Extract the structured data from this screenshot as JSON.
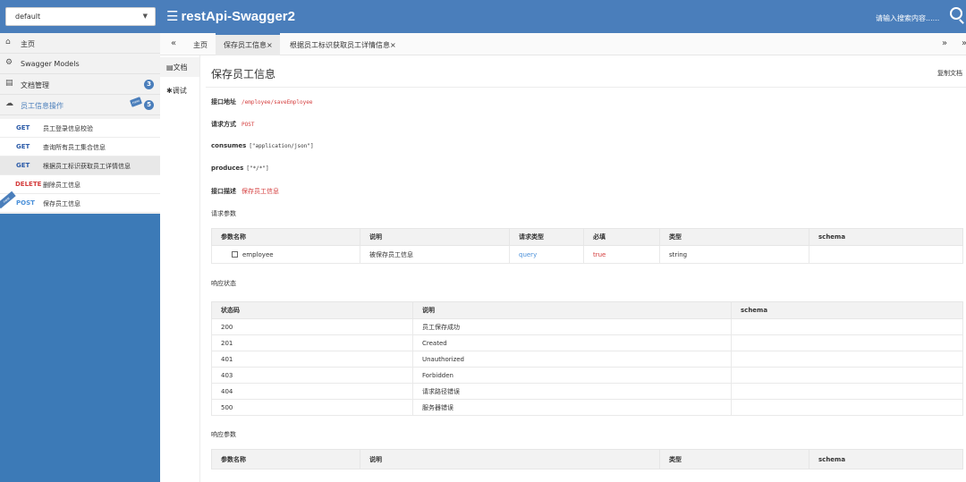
{
  "header": {
    "group_select_value": "default",
    "brand_icon": "menu-bars-icon",
    "brand_title": "restApi-Swagger2",
    "search_placeholder": "请输入搜索内容......"
  },
  "sidebar": {
    "items": [
      {
        "label": "主页",
        "icon": "home-icon"
      },
      {
        "label": "Swagger Models",
        "icon": "gear-icon"
      },
      {
        "label": "文档管理",
        "icon": "document-icon",
        "badge": "3"
      },
      {
        "label": "员工信息操作",
        "icon": "cloud-icon",
        "badge": "5",
        "new_tag": "new"
      }
    ],
    "apis": [
      {
        "method": "GET",
        "label": "员工登录信息校验"
      },
      {
        "method": "GET",
        "label": "查询所有员工集合信息"
      },
      {
        "method": "GET",
        "label": "根据员工标识获取员工详情信息",
        "active": true
      },
      {
        "method": "DELETE",
        "label": "删除员工信息"
      },
      {
        "method": "POST",
        "label": "保存员工信息",
        "ribbon": "new"
      }
    ]
  },
  "tabs": {
    "prev": "«",
    "next": "»",
    "close_all": "»",
    "items": [
      {
        "label": "主页"
      },
      {
        "label": "保存员工信息×",
        "active": true
      },
      {
        "label": "根据员工标识获取员工详情信息×"
      }
    ]
  },
  "vtabs": [
    {
      "label": "文档",
      "icon": "document-icon",
      "active": true
    },
    {
      "label": "调试",
      "icon": "bug-icon"
    }
  ],
  "doc": {
    "title": "保存员工信息",
    "copy_label": "复制文档",
    "url_label": "接口地址",
    "url_value": "/employee/saveEmployee",
    "method_label": "请求方式",
    "method_value": "POST",
    "consumes_label": "consumes",
    "consumes_value": "[\"application/json\"]",
    "produces_label": "produces",
    "produces_value": "[\"*/*\"]",
    "desc_label": "接口描述",
    "desc_value": "保存员工信息",
    "req_params_label": "请求参数",
    "resp_status_label": "响应状态",
    "resp_params_label": "响应参数"
  },
  "request_params": {
    "headers": [
      "参数名称",
      "说明",
      "请求类型",
      "必填",
      "类型",
      "schema"
    ],
    "rows": [
      {
        "name": "employee",
        "desc": "被保存员工信息",
        "in": "query",
        "required": "true",
        "type": "string",
        "schema": ""
      }
    ]
  },
  "response_status": {
    "headers": [
      "状态码",
      "说明",
      "schema"
    ],
    "rows": [
      [
        "200",
        "员工保存成功",
        ""
      ],
      [
        "201",
        "Created",
        ""
      ],
      [
        "401",
        "Unauthorized",
        ""
      ],
      [
        "403",
        "Forbidden",
        ""
      ],
      [
        "404",
        "请求路径错误",
        ""
      ],
      [
        "500",
        "服务器错误",
        ""
      ]
    ]
  },
  "response_params": {
    "headers": [
      "参数名称",
      "说明",
      "类型",
      "schema"
    ]
  }
}
